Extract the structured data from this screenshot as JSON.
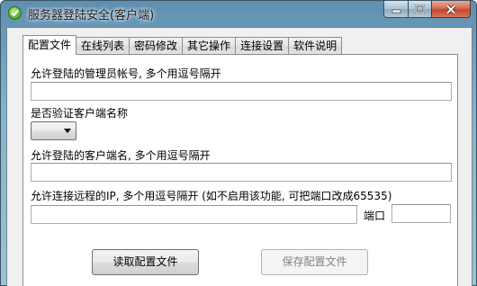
{
  "window": {
    "title": "服务器登陆安全(客户端)"
  },
  "tabs": [
    {
      "label": "配置文件",
      "active": true
    },
    {
      "label": "在线列表",
      "active": false
    },
    {
      "label": "密码修改",
      "active": false
    },
    {
      "label": "其它操作",
      "active": false
    },
    {
      "label": "连接设置",
      "active": false
    },
    {
      "label": "软件说明",
      "active": false
    }
  ],
  "config": {
    "admin_accounts_label": "允许登陆的管理员帐号, 多个用逗号隔开",
    "admin_accounts_value": "",
    "verify_client_label": "是否验证客户端名称",
    "verify_client_value": "",
    "client_names_label": "允许登陆的客户端名, 多个用逗号隔开",
    "client_names_value": "",
    "remote_ip_label": "允许连接远程的IP, 多个用逗号隔开 (如不启用该功能, 可把端口改成65535)",
    "remote_ip_value": "",
    "port_label": "端口",
    "port_value": ""
  },
  "buttons": {
    "read_config": "读取配置文件",
    "save_config": "保存配置文件",
    "save_config_enabled": false
  },
  "icons": {
    "app": "green-shield-check-icon",
    "minimize": "minimize-icon",
    "maximize": "maximize-icon",
    "close": "close-icon"
  }
}
